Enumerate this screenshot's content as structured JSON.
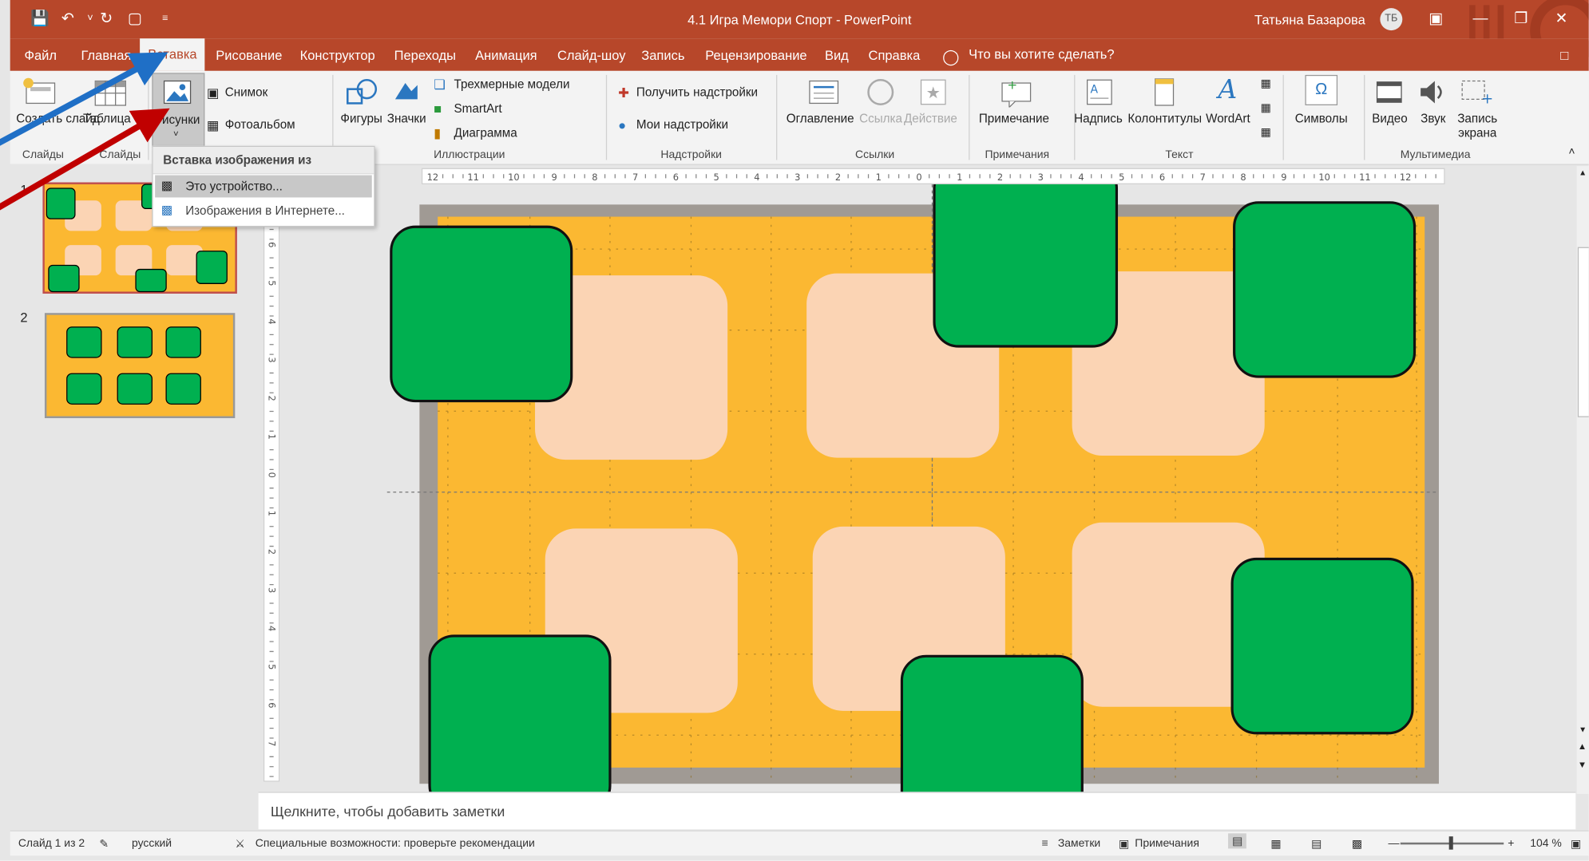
{
  "window": {
    "title": "4.1 Игра Мемори Спорт  -  PowerPoint",
    "user_name": "Татьяна Базарова",
    "user_initials": "ТБ",
    "accent": "#b7472a"
  },
  "tabs": [
    "Файл",
    "Главная",
    "Вставка",
    "Рисование",
    "Конструктор",
    "Переходы",
    "Анимация",
    "Слайд-шоу",
    "Запись",
    "Рецензирование",
    "Вид",
    "Справка"
  ],
  "active_tab": "Вставка",
  "tell_me": "Что вы хотите сделать?",
  "ribbon": {
    "slides": {
      "create_slide": "Создать слайд",
      "group": "Слайды"
    },
    "tables": {
      "table": "Таблица",
      "group": "Таблицы"
    },
    "images": {
      "pictures": "Рисунки",
      "screenshot": "Снимок",
      "photo_album": "Фотоальбом"
    },
    "illustrations": {
      "shapes": "Фигуры",
      "icons": "Значки",
      "models_3d": "Трехмерные модели",
      "smartart": "SmartArt",
      "chart": "Диаграмма",
      "group": "Иллюстрации"
    },
    "addins": {
      "get_addins": "Получить надстройки",
      "my_addins": "Мои надстройки",
      "group": "Надстройки"
    },
    "links": {
      "toc": "Оглавление",
      "link": "Ссылка",
      "action": "Действие",
      "group": "Ссылки"
    },
    "comments": {
      "comment": "Примечание",
      "group": "Примечания"
    },
    "text": {
      "textbox": "Надпись",
      "header_footer": "Колонтитулы",
      "wordart": "WordArt",
      "group": "Текст"
    },
    "symbols": {
      "symbols": "Символы"
    },
    "media": {
      "video": "Видео",
      "audio": "Звук",
      "screen_rec_1": "Запись",
      "screen_rec_2": "экрана",
      "group": "Мультимедиа"
    }
  },
  "dropdown": {
    "header": "Вставка изображения из",
    "items": [
      "Это устройство...",
      "Изображения в Интернете..."
    ]
  },
  "thumbnails": [
    "1",
    "2"
  ],
  "ruler_h": [
    "12",
    "11",
    "10",
    "9",
    "8",
    "7",
    "6",
    "5",
    "4",
    "3",
    "2",
    "1",
    "0",
    "1",
    "2",
    "3",
    "4",
    "5",
    "6",
    "7",
    "8",
    "9",
    "10",
    "11",
    "12"
  ],
  "ruler_v": [
    "7",
    "6",
    "5",
    "4",
    "3",
    "2",
    "1",
    "0",
    "1",
    "2",
    "3",
    "4",
    "5",
    "6",
    "7"
  ],
  "notes_placeholder": "Щелкните, чтобы добавить заметки",
  "status": {
    "slide_info": "Слайд 1 из 2",
    "language": "русский",
    "accessibility": "Специальные возможности: проверьте рекомендации",
    "notes": "Заметки",
    "comments": "Примечания",
    "zoom": "104 %"
  },
  "colors": {
    "slide_bg": "#fbb832",
    "card_back": "#fbd4b4",
    "card_front": "#00b050",
    "frame": "#a09a94",
    "arrow_blue": "#1f6fc6",
    "arrow_red": "#c00000"
  }
}
